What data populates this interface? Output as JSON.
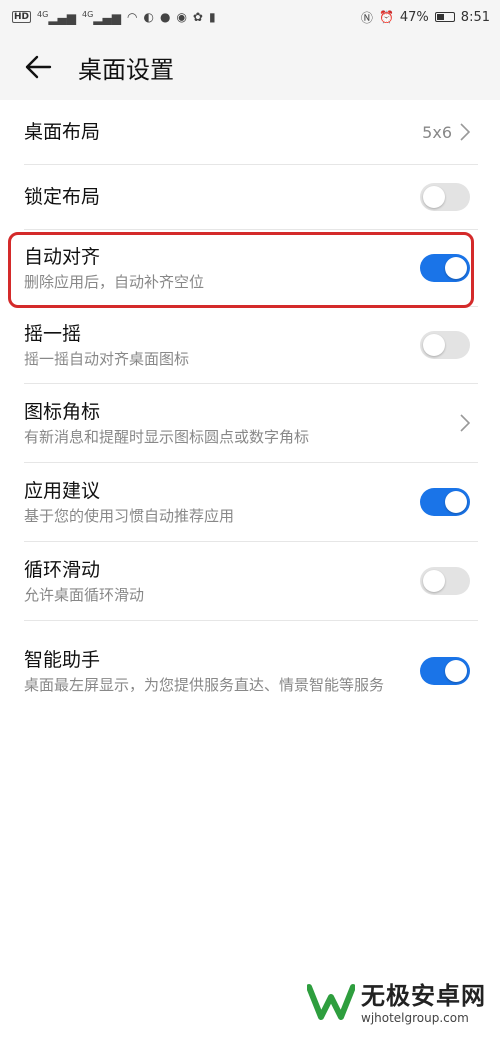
{
  "statusbar": {
    "left_hd": "HD",
    "signal1": "4G",
    "signal2": "4G",
    "battery_pct": "47%",
    "time": "8:51",
    "battery_level": 0.47
  },
  "appbar": {
    "title": "桌面设置"
  },
  "settings": [
    {
      "label": "桌面布局",
      "value": "5x6"
    },
    {
      "label": "锁定布局",
      "enabled": false
    },
    {
      "label": "自动对齐",
      "sub": "删除应用后，自动补齐空位",
      "enabled": true
    },
    {
      "label": "摇一摇",
      "sub": "摇一摇自动对齐桌面图标",
      "enabled": false
    },
    {
      "label": "图标角标",
      "sub": "有新消息和提醒时显示图标圆点或数字角标"
    },
    {
      "label": "应用建议",
      "sub": "基于您的使用习惯自动推荐应用",
      "enabled": true
    },
    {
      "label": "循环滑动",
      "sub": "允许桌面循环滑动",
      "enabled": false
    },
    {
      "label": "智能助手",
      "sub": "桌面最左屏显示，为您提供服务直达、情景智能等服务",
      "enabled": true
    }
  ],
  "watermark": {
    "title": "无极安卓网",
    "url": "wjhotelgroup.com"
  },
  "colors": {
    "accent": "#1a74e8",
    "highlight": "#d42a2a"
  }
}
